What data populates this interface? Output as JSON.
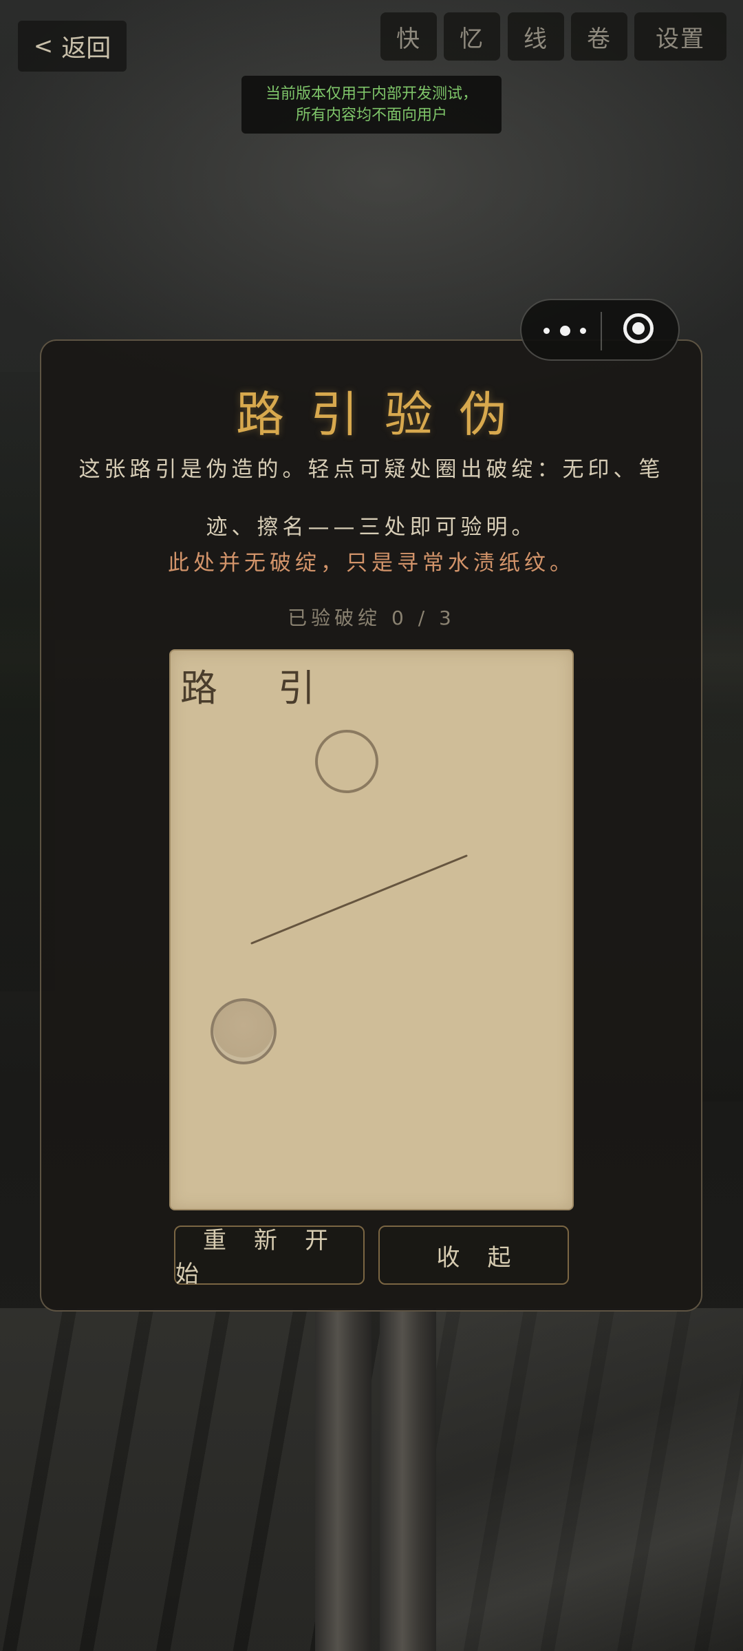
{
  "nav": {
    "back_label": "返回",
    "tabs": [
      "快",
      "忆",
      "线",
      "卷",
      "设置"
    ]
  },
  "banner": {
    "line1": "当前版本仅用于内部开发测试，",
    "line2": "所有内容均不面向用户"
  },
  "capsule": {
    "more_icon": "more-dots-icon",
    "close_icon": "target-circle-icon"
  },
  "puzzle": {
    "title": "路引验伪",
    "description": "这张路引是伪造的。轻点可疑处圈出破绽：无印、笔迹、擦名——三处即可验明。",
    "hint": "此处并无破绽，只是寻常水渍纸纹。",
    "progress_label": "已验破绽 0 / 3",
    "found": 0,
    "total": 3,
    "paper_title": "路引"
  },
  "actions": {
    "restart_label": "重新开始",
    "collapse_label": "收起"
  },
  "colors": {
    "title_gold": "#d8a94e",
    "hint_orange": "#d3946a",
    "banner_green": "#7fc66a",
    "paper": "#cfbd98"
  }
}
